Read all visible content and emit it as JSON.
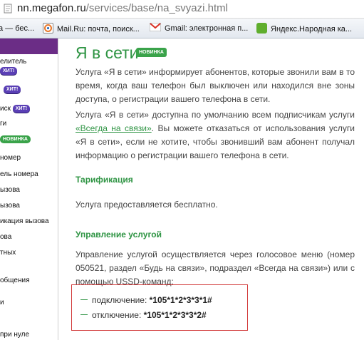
{
  "browser": {
    "url_host": "nn.megafon.ru",
    "url_path": "/services/base/na_svyazi.html",
    "bookmarks": [
      {
        "label": "а — бес...",
        "icon": "page-icon"
      },
      {
        "label": "Mail.Ru: почта, поиск...",
        "icon": "mailru-icon"
      },
      {
        "label": "Gmail: электронная п...",
        "icon": "gmail-icon"
      },
      {
        "label": "Яндекс.Народная ка...",
        "icon": "puzzle-icon"
      }
    ]
  },
  "sidebar": {
    "items": [
      {
        "label": "елитель"
      },
      {
        "label": "иск"
      },
      {
        "label": "ги"
      },
      {
        "label": "номер"
      },
      {
        "label": "ель номера"
      },
      {
        "label": "ызова"
      },
      {
        "label": "ызова"
      },
      {
        "label": "икация вызова"
      },
      {
        "label": "ова"
      },
      {
        "label": "тных"
      },
      {
        "label": "общения"
      },
      {
        "label": "и"
      },
      {
        "label": "при нуле"
      }
    ],
    "badge_hit": "ХИТ!",
    "badge_new": "НОВИНКА"
  },
  "main": {
    "title": "Я в сети",
    "title_badge": "НОВИНКА",
    "para1": "Услуга «Я в сети» информирует абонентов, которые звонили вам в то время, когда ваш телефон был выключен или находился вне зоны доступа, о регистрации вашего телефона в сети.",
    "para2_before": "Услуга «Я в сети» доступна по умолчанию всем подписчикам услуги ",
    "para2_link": "«Всегда на связи»",
    "para2_after": ". Вы можете отказаться от использования услуги «Я в сети», если не хотите, чтобы звонивший вам абонент получал информацию о регистрации вашего телефона в сети.",
    "h_tariff": "Тарификация",
    "tariff_text": "Услуга предоставляется бесплатно.",
    "h_manage": "Управление услугой",
    "manage_text": "Управление услугой осуществляется через голосовое меню (номер 050521, раздел «Будь на связи», подраздел «Всегда на связи») или с помощью USSD-команд:",
    "cmd_on_label": "подключение:",
    "cmd_on_code": "*105*1*2*3*3*1#",
    "cmd_off_label": "отключение:",
    "cmd_off_code": "*105*1*2*3*3*2#"
  }
}
